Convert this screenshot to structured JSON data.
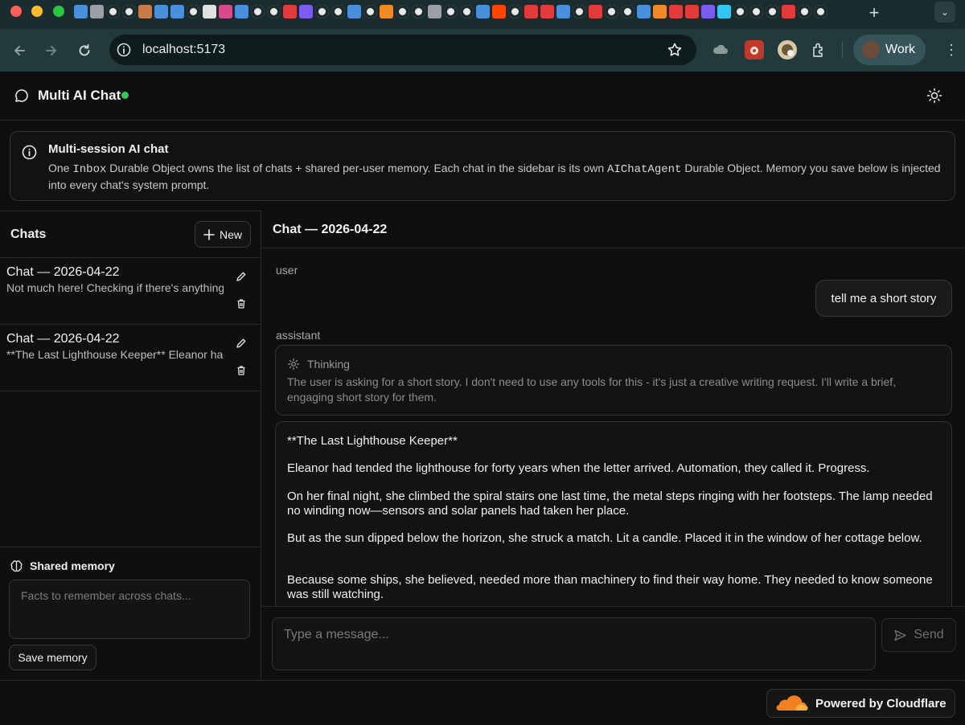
{
  "browser": {
    "url": "localhost:5173",
    "profile_name": "Work",
    "tab_favicon_colors": [
      "#4a8fd9",
      "#9aa0a6",
      "#ffffff",
      "#ffffff",
      "#c97a4a",
      "#4a8fd9",
      "#4a8fd9",
      "#ffffff",
      "#e0e0e0",
      "#d94a8c",
      "#4a8fd9",
      "#ffffff",
      "#ffffff",
      "#e03a3a",
      "#7a5cf0",
      "#ffffff",
      "#ffffff",
      "#4a8fd9",
      "#ffffff",
      "#f08a24",
      "#ffffff",
      "#ffffff",
      "#9aa0a6",
      "#ffffff",
      "#ffffff",
      "#4a8fd9",
      "#ff4500",
      "#ffffff",
      "#e03a3a",
      "#e03a3a",
      "#4a8fd9",
      "#ffffff",
      "#e03a3a",
      "#ffffff",
      "#ffffff",
      "#4a8fd9",
      "#f08a24",
      "#e03a3a",
      "#e03a3a",
      "#7a5cf0",
      "#36c5f0",
      "#ffffff",
      "#ffffff",
      "#ffffff",
      "#e03a3a",
      "#ffffff",
      "#ffffff",
      "#f08a24",
      "#ffffff",
      "#ffffff",
      "#ffffff",
      "#e0e0e0",
      "#ffffff"
    ]
  },
  "app": {
    "title": "Multi AI Chat",
    "status_color": "#34c759"
  },
  "banner": {
    "title": "Multi-session AI chat",
    "text_1": "One ",
    "code_1": "Inbox",
    "text_2": " Durable Object owns the list of chats + shared per-user memory. Each chat in the sidebar is its own ",
    "code_2": "AIChatAgent",
    "text_3": " Durable Object. Memory you save below is injected into every chat's system prompt."
  },
  "sidebar": {
    "heading": "Chats",
    "new_label": "New",
    "chats": [
      {
        "title": "Chat — 2026-04-22",
        "preview": "Not much here! Checking if there's anything"
      },
      {
        "title": "Chat — 2026-04-22",
        "preview": "**The Last Lighthouse Keeper** Eleanor had"
      }
    ],
    "memory_title": "Shared memory",
    "memory_placeholder": "Facts to remember across chats...",
    "save_label": "Save memory"
  },
  "chat": {
    "title": "Chat — 2026-04-22",
    "user_role": "user",
    "user_message": "tell me a short story",
    "assistant_role": "assistant",
    "thinking_label": "Thinking",
    "thinking_text": "The user is asking for a short story. I don't need to use any tools for this - it's just a creative writing request. I'll write a brief, engaging short story for them.",
    "story": [
      "**The Last Lighthouse Keeper**",
      "Eleanor had tended the lighthouse for forty years when the letter arrived. Automation, they called it. Progress.",
      "On her final night, she climbed the spiral stairs one last time, the metal steps ringing with her footsteps. The lamp needed no winding now—sensors and solar panels had taken her place.",
      "But as the sun dipped below the horizon, she struck a match. Lit a candle. Placed it in the window of her cottage below.",
      "Because some ships, she believed, needed more than machinery to find their way home. They needed to know someone was still watching."
    ],
    "input_placeholder": "Type a message...",
    "send_label": "Send"
  },
  "footer": {
    "badge_text": "Powered by Cloudflare",
    "brand_color": "#f38020"
  }
}
